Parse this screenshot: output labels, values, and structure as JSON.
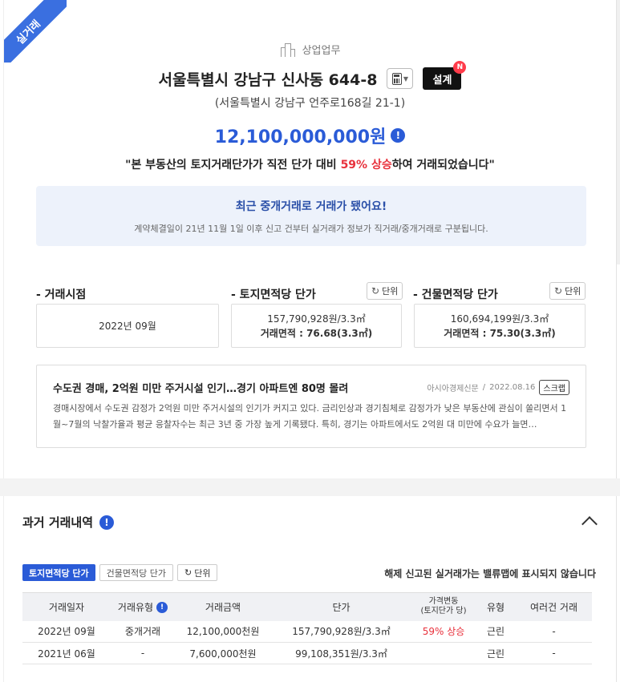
{
  "badge": {
    "label": "실거래"
  },
  "header": {
    "category": "상업업무",
    "category_icon": "building-icon",
    "address": "서울특별시 강남구 신사동 644-8",
    "calculator_icon": "calculator-icon",
    "design_button": "설계",
    "new_badge": "N",
    "road_address": "(서울특별시 강남구 언주로168길 21-1)",
    "price": "12,100,000,000원",
    "info_icon": "!",
    "notice_prefix": "\"본 부동산의 토지거래단가가 직전 단가 대비 ",
    "notice_highlight": "59% 상승",
    "notice_suffix": "하여 거래되었습니다\""
  },
  "broker_notice": {
    "title": "최근 중개거래로 거래가 됐어요!",
    "description": "계약체결일이 21년 11월 1일 이후 신고 건부터 실거래가 정보가 직거래/중개거래로 구분됩니다."
  },
  "stats": {
    "trade_time_label": "- 거래시점",
    "trade_time_value": "2022년 09월",
    "land_unit_label": "- 토지면적당 단가",
    "land_unit_price": "157,790,928원/3.3㎡",
    "land_area": "거래면적 : 76.68(3.3㎡)",
    "building_unit_label": "- 건물면적당 단가",
    "building_unit_price": "160,694,199원/3.3㎡",
    "building_area": "거래면적 : 75.30(3.3㎡)",
    "unit_button": "단위",
    "refresh_symbol": "↻"
  },
  "news": {
    "title": "수도권 경매, 2억원 미만 주거시설 인기…경기 아파트엔 80명 몰려",
    "source": "아시아경제신문",
    "separator": "/",
    "date": "2022.08.16",
    "scrap_button": "스크랩",
    "body": "경매시장에서 수도권 감정가 2억원 미만 주거시설의 인기가 커지고 있다. 금리인상과 경기침체로 감정가가 낮은 부동산에 관심이 쏠리면서 1월~7월의 낙찰가율과 평균 응찰자수는 최근 3년 중 가장 높게 기록됐다. 특히, 경기는 아파트에서도 2억원 대 미만에 수요가 늘면…"
  },
  "history": {
    "title": "과거 거래내역",
    "tabs": {
      "land": "토지면적당 단가",
      "building": "건물면적당 단가",
      "unit": "단위"
    },
    "notice": "해제 신고된 실거래가는 밸류맵에 표시되지 않습니다",
    "columns": [
      "거래일자",
      "거래유형",
      "거래금액",
      "단가",
      "가격변동\n(토지단가 당)",
      "유형",
      "여러건 거래"
    ],
    "col_price_change_line1": "가격변동",
    "col_price_change_line2": "(토지단가 당)",
    "rows": [
      {
        "date": "2022년 09월",
        "type": "중개거래",
        "amount": "12,100,000천원",
        "unit_price": "157,790,928원/3.3㎡",
        "change": "59% 상승",
        "category": "근린",
        "multi": "-"
      },
      {
        "date": "2021년 06월",
        "type": "-",
        "amount": "7,600,000천원",
        "unit_price": "99,108,351원/3.3㎡",
        "change": "",
        "category": "근린",
        "multi": "-"
      }
    ]
  },
  "colors": {
    "accent": "#2a5bd7",
    "highlight": "#e8313c",
    "ribbon": "#3a6fe0"
  }
}
